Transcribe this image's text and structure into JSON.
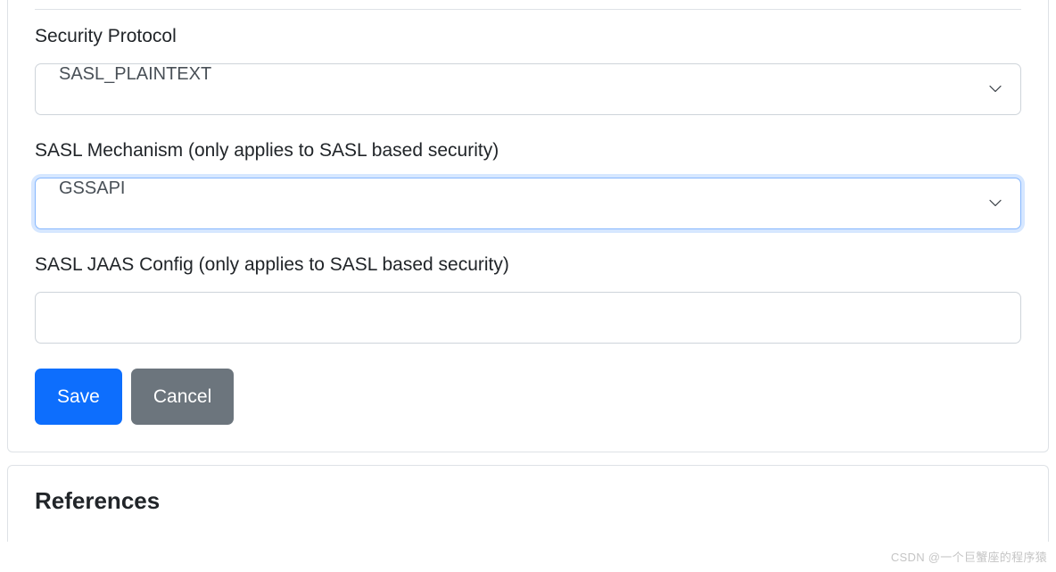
{
  "form": {
    "securityProtocol": {
      "label": "Security Protocol",
      "value": "SASL_PLAINTEXT"
    },
    "saslMechanism": {
      "label": "SASL Mechanism (only applies to SASL based security)",
      "value": "GSSAPI"
    },
    "saslJaasConfig": {
      "label": "SASL JAAS Config (only applies to SASL based security)",
      "value": ""
    },
    "buttons": {
      "save": "Save",
      "cancel": "Cancel"
    }
  },
  "references": {
    "title": "References"
  },
  "watermark": "CSDN @一个巨蟹座的程序猿"
}
